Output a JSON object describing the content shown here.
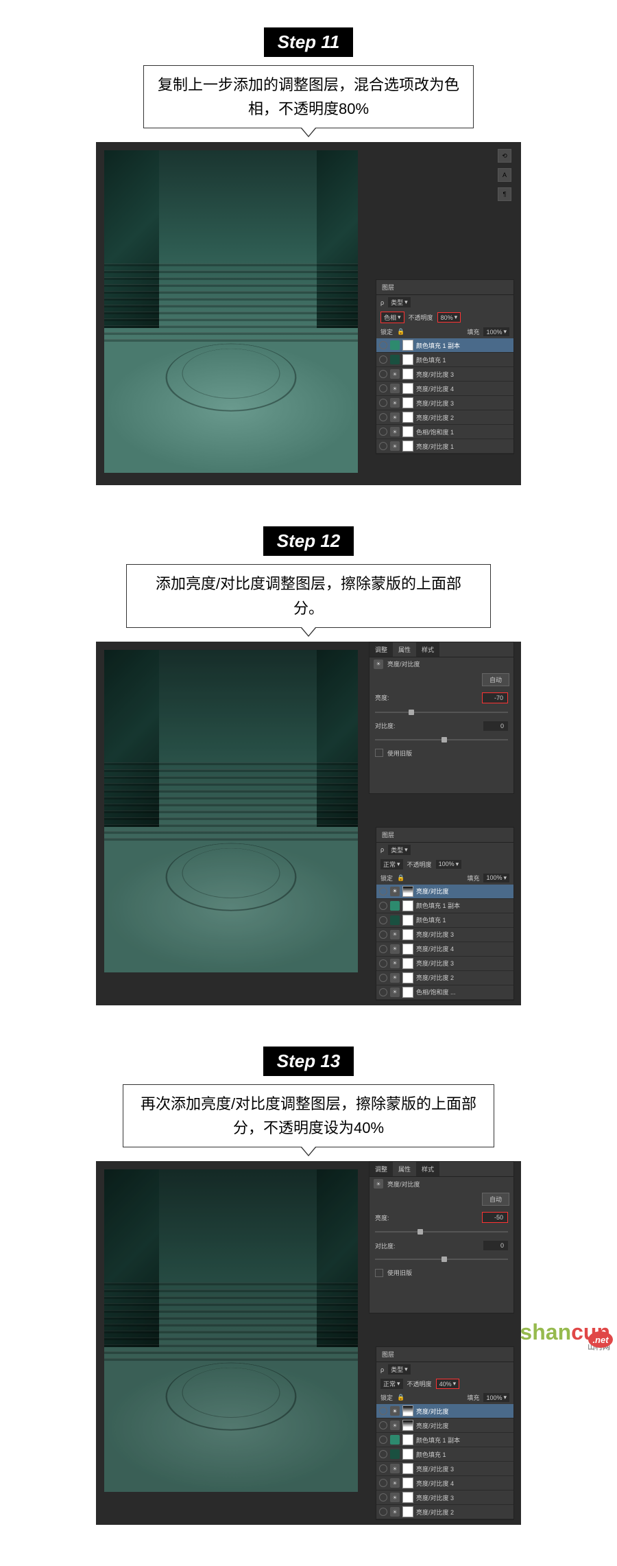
{
  "watermark": {
    "text1": "shan",
    "text2": "cun",
    "sub": "山村网",
    "net": ".net"
  },
  "steps": [
    {
      "label": "Step 11",
      "caption": "复制上一步添加的调整图层，混合选项改为色相，不透明度80%",
      "layers_panel": {
        "tab": "图层",
        "type_label": "类型",
        "blend": "色相",
        "opacity_label": "不透明度",
        "opacity": "80%",
        "lock_label": "锁定",
        "fill_label": "填充",
        "fill": "100%",
        "layers": [
          {
            "name": "颜色填充 1 副本",
            "kind": "fill",
            "selected": true
          },
          {
            "name": "颜色填充 1",
            "kind": "fill2"
          },
          {
            "name": "亮度/对比度 3",
            "kind": "sun"
          },
          {
            "name": "亮度/对比度 4",
            "kind": "sun"
          },
          {
            "name": "亮度/对比度 3",
            "kind": "sun"
          },
          {
            "name": "亮度/对比度 2",
            "kind": "sun"
          },
          {
            "name": "色相/饱和度 1",
            "kind": "sun"
          },
          {
            "name": "亮度/对比度 1",
            "kind": "sun"
          }
        ]
      }
    },
    {
      "label": "Step 12",
      "caption": "添加亮度/对比度调整图层，擦除蒙版的上面部分。",
      "props_panel": {
        "tabs": [
          "调整",
          "属性",
          "样式"
        ],
        "title": "亮度/对比度",
        "auto": "自动",
        "brightness_label": "亮度:",
        "brightness": "-70",
        "contrast_label": "对比度:",
        "contrast": "0",
        "legacy": "使用旧版"
      },
      "layers_panel": {
        "tab": "图层",
        "type_label": "类型",
        "blend": "正常",
        "opacity_label": "不透明度",
        "opacity": "100%",
        "lock_label": "锁定",
        "fill_label": "填充",
        "fill": "100%",
        "layers": [
          {
            "name": "亮度/对比度",
            "kind": "sun",
            "selected": true,
            "maskgrad": true
          },
          {
            "name": "颜色填充 1 副本",
            "kind": "fill"
          },
          {
            "name": "颜色填充 1",
            "kind": "fill2"
          },
          {
            "name": "亮度/对比度 3",
            "kind": "sun"
          },
          {
            "name": "亮度/对比度 4",
            "kind": "sun"
          },
          {
            "name": "亮度/对比度 3",
            "kind": "sun"
          },
          {
            "name": "亮度/对比度 2",
            "kind": "sun"
          },
          {
            "name": "色相/饱和度 ...",
            "kind": "sun"
          }
        ]
      }
    },
    {
      "label": "Step 13",
      "caption": "再次添加亮度/对比度调整图层，擦除蒙版的上面部分，不透明度设为40%",
      "props_panel": {
        "tabs": [
          "调整",
          "属性",
          "样式"
        ],
        "title": "亮度/对比度",
        "auto": "自动",
        "brightness_label": "亮度:",
        "brightness": "-50",
        "contrast_label": "对比度:",
        "contrast": "0",
        "legacy": "使用旧版"
      },
      "layers_panel": {
        "tab": "图层",
        "type_label": "类型",
        "blend": "正常",
        "opacity_label": "不透明度",
        "opacity": "40%",
        "lock_label": "锁定",
        "fill_label": "填充",
        "fill": "100%",
        "layers": [
          {
            "name": "亮度/对比度",
            "kind": "sun",
            "selected": true,
            "maskgrad": true
          },
          {
            "name": "亮度/对比度",
            "kind": "sun",
            "maskgrad": true
          },
          {
            "name": "颜色填充 1 副本",
            "kind": "fill"
          },
          {
            "name": "颜色填充 1",
            "kind": "fill2"
          },
          {
            "name": "亮度/对比度 3",
            "kind": "sun"
          },
          {
            "name": "亮度/对比度 4",
            "kind": "sun"
          },
          {
            "name": "亮度/对比度 3",
            "kind": "sun"
          },
          {
            "name": "亮度/对比度 2",
            "kind": "sun"
          }
        ]
      }
    }
  ]
}
